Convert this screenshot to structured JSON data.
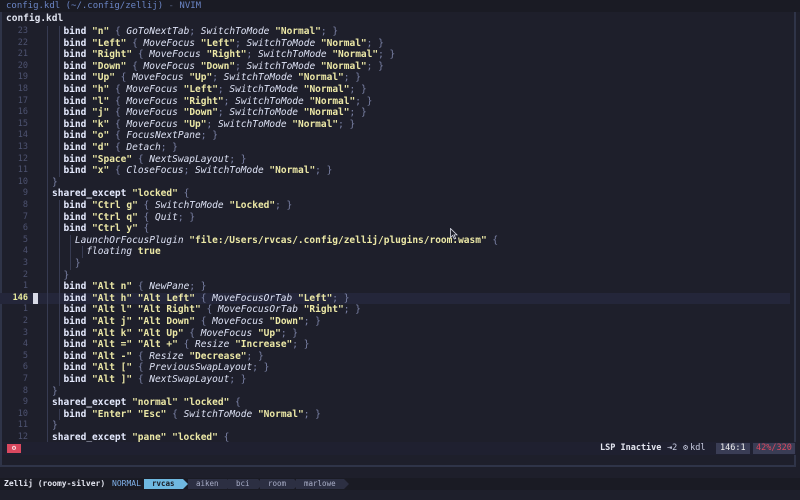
{
  "window": {
    "title_file": "config.kdl (~/.config/zellij)",
    "title_sep": " - ",
    "title_app": "NVIM"
  },
  "tabline": {
    "label": "config.kdl"
  },
  "editor": {
    "lines": [
      {
        "n": "23",
        "i": 3,
        "t": [
          [
            "kw",
            "bind "
          ],
          [
            "str",
            "\"n\""
          ],
          [
            "pn",
            " { "
          ],
          [
            "fn",
            "GoToNextTab"
          ],
          [
            "pn",
            "; "
          ],
          [
            "fn",
            "SwitchToMode "
          ],
          [
            "str",
            "\"Normal\""
          ],
          [
            "pn",
            "; }"
          ]
        ]
      },
      {
        "n": "22",
        "i": 3,
        "t": [
          [
            "kw",
            "bind "
          ],
          [
            "str",
            "\"Left\""
          ],
          [
            "pn",
            " { "
          ],
          [
            "fn",
            "MoveFocus "
          ],
          [
            "str",
            "\"Left\""
          ],
          [
            "pn",
            "; "
          ],
          [
            "fn",
            "SwitchToMode "
          ],
          [
            "str",
            "\"Normal\""
          ],
          [
            "pn",
            "; }"
          ]
        ]
      },
      {
        "n": "21",
        "i": 3,
        "t": [
          [
            "kw",
            "bind "
          ],
          [
            "str",
            "\"Right\""
          ],
          [
            "pn",
            " { "
          ],
          [
            "fn",
            "MoveFocus "
          ],
          [
            "str",
            "\"Right\""
          ],
          [
            "pn",
            "; "
          ],
          [
            "fn",
            "SwitchToMode "
          ],
          [
            "str",
            "\"Normal\""
          ],
          [
            "pn",
            "; }"
          ]
        ]
      },
      {
        "n": "20",
        "i": 3,
        "t": [
          [
            "kw",
            "bind "
          ],
          [
            "str",
            "\"Down\""
          ],
          [
            "pn",
            " { "
          ],
          [
            "fn",
            "MoveFocus "
          ],
          [
            "str",
            "\"Down\""
          ],
          [
            "pn",
            "; "
          ],
          [
            "fn",
            "SwitchToMode "
          ],
          [
            "str",
            "\"Normal\""
          ],
          [
            "pn",
            "; }"
          ]
        ]
      },
      {
        "n": "19",
        "i": 3,
        "t": [
          [
            "kw",
            "bind "
          ],
          [
            "str",
            "\"Up\""
          ],
          [
            "pn",
            " { "
          ],
          [
            "fn",
            "MoveFocus "
          ],
          [
            "str",
            "\"Up\""
          ],
          [
            "pn",
            "; "
          ],
          [
            "fn",
            "SwitchToMode "
          ],
          [
            "str",
            "\"Normal\""
          ],
          [
            "pn",
            "; }"
          ]
        ]
      },
      {
        "n": "18",
        "i": 3,
        "t": [
          [
            "kw",
            "bind "
          ],
          [
            "str",
            "\"h\""
          ],
          [
            "pn",
            " { "
          ],
          [
            "fn",
            "MoveFocus "
          ],
          [
            "str",
            "\"Left\""
          ],
          [
            "pn",
            "; "
          ],
          [
            "fn",
            "SwitchToMode "
          ],
          [
            "str",
            "\"Normal\""
          ],
          [
            "pn",
            "; }"
          ]
        ]
      },
      {
        "n": "17",
        "i": 3,
        "t": [
          [
            "kw",
            "bind "
          ],
          [
            "str",
            "\"l\""
          ],
          [
            "pn",
            " { "
          ],
          [
            "fn",
            "MoveFocus "
          ],
          [
            "str",
            "\"Right\""
          ],
          [
            "pn",
            "; "
          ],
          [
            "fn",
            "SwitchToMode "
          ],
          [
            "str",
            "\"Normal\""
          ],
          [
            "pn",
            "; }"
          ]
        ]
      },
      {
        "n": "16",
        "i": 3,
        "t": [
          [
            "kw",
            "bind "
          ],
          [
            "str",
            "\"j\""
          ],
          [
            "pn",
            " { "
          ],
          [
            "fn",
            "MoveFocus "
          ],
          [
            "str",
            "\"Down\""
          ],
          [
            "pn",
            "; "
          ],
          [
            "fn",
            "SwitchToMode "
          ],
          [
            "str",
            "\"Normal\""
          ],
          [
            "pn",
            "; }"
          ]
        ]
      },
      {
        "n": "15",
        "i": 3,
        "t": [
          [
            "kw",
            "bind "
          ],
          [
            "str",
            "\"k\""
          ],
          [
            "pn",
            " { "
          ],
          [
            "fn",
            "MoveFocus "
          ],
          [
            "str",
            "\"Up\""
          ],
          [
            "pn",
            "; "
          ],
          [
            "fn",
            "SwitchToMode "
          ],
          [
            "str",
            "\"Normal\""
          ],
          [
            "pn",
            "; }"
          ]
        ]
      },
      {
        "n": "14",
        "i": 3,
        "t": [
          [
            "kw",
            "bind "
          ],
          [
            "str",
            "\"o\""
          ],
          [
            "pn",
            " { "
          ],
          [
            "fn",
            "FocusNextPane"
          ],
          [
            "pn",
            "; }"
          ]
        ]
      },
      {
        "n": "13",
        "i": 3,
        "t": [
          [
            "kw",
            "bind "
          ],
          [
            "str",
            "\"d\""
          ],
          [
            "pn",
            " { "
          ],
          [
            "fn",
            "Detach"
          ],
          [
            "pn",
            "; }"
          ]
        ]
      },
      {
        "n": "12",
        "i": 3,
        "t": [
          [
            "kw",
            "bind "
          ],
          [
            "str",
            "\"Space\""
          ],
          [
            "pn",
            " { "
          ],
          [
            "fn",
            "NextSwapLayout"
          ],
          [
            "pn",
            "; }"
          ]
        ]
      },
      {
        "n": "11",
        "i": 3,
        "t": [
          [
            "kw",
            "bind "
          ],
          [
            "str",
            "\"x\""
          ],
          [
            "pn",
            " { "
          ],
          [
            "fn",
            "CloseFocus"
          ],
          [
            "pn",
            "; "
          ],
          [
            "fn",
            "SwitchToMode "
          ],
          [
            "str",
            "\"Normal\""
          ],
          [
            "pn",
            "; }"
          ]
        ]
      },
      {
        "n": "10",
        "i": 2,
        "t": [
          [
            "pn",
            "}"
          ]
        ]
      },
      {
        "n": "9",
        "i": 2,
        "t": [
          [
            "kw",
            "shared_except "
          ],
          [
            "str",
            "\"locked\""
          ],
          [
            "pn",
            " {"
          ]
        ]
      },
      {
        "n": "8",
        "i": 3,
        "t": [
          [
            "kw",
            "bind "
          ],
          [
            "str",
            "\"Ctrl g\""
          ],
          [
            "pn",
            " { "
          ],
          [
            "fn",
            "SwitchToMode "
          ],
          [
            "str",
            "\"Locked\""
          ],
          [
            "pn",
            "; }"
          ]
        ]
      },
      {
        "n": "7",
        "i": 3,
        "t": [
          [
            "kw",
            "bind "
          ],
          [
            "str",
            "\"Ctrl q\""
          ],
          [
            "pn",
            " { "
          ],
          [
            "fn",
            "Quit"
          ],
          [
            "pn",
            "; }"
          ]
        ]
      },
      {
        "n": "6",
        "i": 3,
        "t": [
          [
            "kw",
            "bind "
          ],
          [
            "str",
            "\"Ctrl y\""
          ],
          [
            "pn",
            " {"
          ]
        ]
      },
      {
        "n": "5",
        "i": 4,
        "t": [
          [
            "fn",
            "LaunchOrFocusPlugin "
          ],
          [
            "str",
            "\"file:/Users/rvcas/.config/zellij/plugins/room.wasm\""
          ],
          [
            "pn",
            " {"
          ]
        ]
      },
      {
        "n": "4",
        "i": 5,
        "t": [
          [
            "fn",
            "floating "
          ],
          [
            "bool",
            "true"
          ]
        ]
      },
      {
        "n": "3",
        "i": 4,
        "t": [
          [
            "pn",
            "}"
          ]
        ]
      },
      {
        "n": "2",
        "i": 3,
        "t": [
          [
            "pn",
            "}"
          ]
        ]
      },
      {
        "n": "1",
        "i": 3,
        "t": [
          [
            "kw",
            "bind "
          ],
          [
            "str",
            "\"Alt n\""
          ],
          [
            "pn",
            " { "
          ],
          [
            "fn",
            "NewPane"
          ],
          [
            "pn",
            "; }"
          ]
        ]
      },
      {
        "n": "146",
        "i": 3,
        "cur": true,
        "t": [
          [
            "kw",
            "bind "
          ],
          [
            "str",
            "\"Alt h\" \"Alt Left\""
          ],
          [
            "pn",
            " { "
          ],
          [
            "fn",
            "MoveFocusOrTab "
          ],
          [
            "str",
            "\"Left\""
          ],
          [
            "pn",
            "; }"
          ]
        ]
      },
      {
        "n": "1",
        "i": 3,
        "t": [
          [
            "kw",
            "bind "
          ],
          [
            "str",
            "\"Alt l\" \"Alt Right\""
          ],
          [
            "pn",
            " { "
          ],
          [
            "fn",
            "MoveFocusOrTab "
          ],
          [
            "str",
            "\"Right\""
          ],
          [
            "pn",
            "; }"
          ]
        ]
      },
      {
        "n": "2",
        "i": 3,
        "t": [
          [
            "kw",
            "bind "
          ],
          [
            "str",
            "\"Alt j\" \"Alt Down\""
          ],
          [
            "pn",
            " { "
          ],
          [
            "fn",
            "MoveFocus "
          ],
          [
            "str",
            "\"Down\""
          ],
          [
            "pn",
            "; }"
          ]
        ]
      },
      {
        "n": "3",
        "i": 3,
        "t": [
          [
            "kw",
            "bind "
          ],
          [
            "str",
            "\"Alt k\" \"Alt Up\""
          ],
          [
            "pn",
            " { "
          ],
          [
            "fn",
            "MoveFocus "
          ],
          [
            "str",
            "\"Up\""
          ],
          [
            "pn",
            "; }"
          ]
        ]
      },
      {
        "n": "4",
        "i": 3,
        "t": [
          [
            "kw",
            "bind "
          ],
          [
            "str",
            "\"Alt =\" \"Alt +\""
          ],
          [
            "pn",
            " { "
          ],
          [
            "fn",
            "Resize "
          ],
          [
            "str",
            "\"Increase\""
          ],
          [
            "pn",
            "; }"
          ]
        ]
      },
      {
        "n": "5",
        "i": 3,
        "t": [
          [
            "kw",
            "bind "
          ],
          [
            "str",
            "\"Alt -\""
          ],
          [
            "pn",
            " { "
          ],
          [
            "fn",
            "Resize "
          ],
          [
            "str",
            "\"Decrease\""
          ],
          [
            "pn",
            "; }"
          ]
        ]
      },
      {
        "n": "6",
        "i": 3,
        "t": [
          [
            "kw",
            "bind "
          ],
          [
            "str",
            "\"Alt [\""
          ],
          [
            "pn",
            " { "
          ],
          [
            "fn",
            "PreviousSwapLayout"
          ],
          [
            "pn",
            "; }"
          ]
        ]
      },
      {
        "n": "7",
        "i": 3,
        "t": [
          [
            "kw",
            "bind "
          ],
          [
            "str",
            "\"Alt ]\""
          ],
          [
            "pn",
            " { "
          ],
          [
            "fn",
            "NextSwapLayout"
          ],
          [
            "pn",
            "; }"
          ]
        ]
      },
      {
        "n": "8",
        "i": 2,
        "t": [
          [
            "pn",
            "}"
          ]
        ]
      },
      {
        "n": "9",
        "i": 2,
        "t": [
          [
            "kw",
            "shared_except "
          ],
          [
            "str",
            "\"normal\" \"locked\""
          ],
          [
            "pn",
            " {"
          ]
        ]
      },
      {
        "n": "10",
        "i": 3,
        "t": [
          [
            "kw",
            "bind "
          ],
          [
            "str",
            "\"Enter\" \"Esc\""
          ],
          [
            "pn",
            " { "
          ],
          [
            "fn",
            "SwitchToMode "
          ],
          [
            "str",
            "\"Normal\""
          ],
          [
            "pn",
            "; }"
          ]
        ]
      },
      {
        "n": "11",
        "i": 2,
        "t": [
          [
            "pn",
            "}"
          ]
        ]
      },
      {
        "n": "12",
        "i": 2,
        "t": [
          [
            "kw",
            "shared_except "
          ],
          [
            "str",
            "\"pane\" \"locked\""
          ],
          [
            "pn",
            " {"
          ]
        ]
      }
    ]
  },
  "statusline": {
    "mode_icon": "gear-icon",
    "lsp": "LSP Inactive",
    "tab_indicator": "⇥2",
    "filetype_icon": "gear-icon",
    "filetype": "kdl",
    "position": "146:1",
    "percent": "42%/320"
  },
  "zellij": {
    "session": "Zellij (roomy-silver)",
    "mode": "NORMAL",
    "tabs": [
      {
        "label": "rvcas",
        "active": true
      },
      {
        "label": "aiken",
        "active": false
      },
      {
        "label": "bci",
        "active": false
      },
      {
        "label": "room",
        "active": false
      },
      {
        "label": "marlowe",
        "active": false
      }
    ]
  },
  "colors": {
    "background": "#1e1f2b",
    "accent": "#6fb8e0",
    "error": "#d9485f",
    "string": "#ece8a6"
  }
}
